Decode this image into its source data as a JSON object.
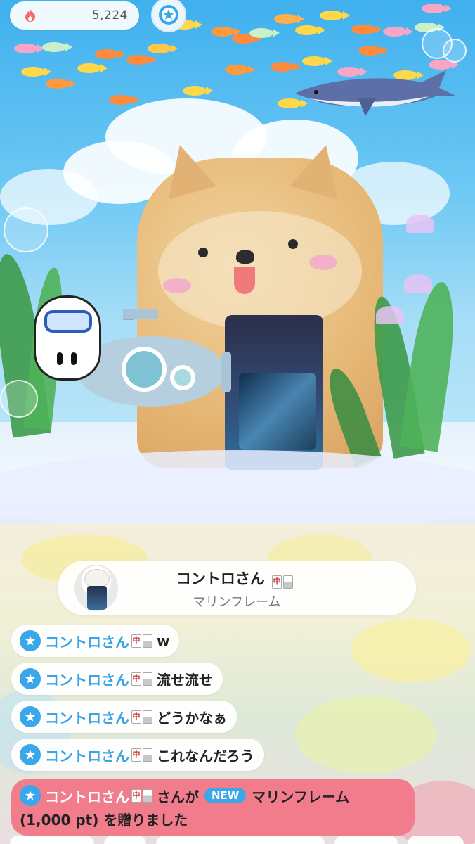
{
  "header": {
    "point_count": "5,224",
    "point_icon": "flame-icon",
    "badge_icon": "star-badge-icon"
  },
  "gift_banner": {
    "user_name": "コントロさん",
    "item_name": "マリンフレーム"
  },
  "chat": {
    "messages": [
      {
        "user": "コントロさん",
        "text": "w"
      },
      {
        "user": "コントロさん",
        "text": "流せ流せ"
      },
      {
        "user": "コントロさん",
        "text": "どうかなぁ"
      },
      {
        "user": "コントロさん",
        "text": "これなんだろう"
      }
    ],
    "gift_message": {
      "user": "コントロさん",
      "suffix": "さんが",
      "badge": "NEW",
      "item": "マリンフレーム",
      "line2": "(1,000 pt) を贈りました"
    }
  },
  "colors": {
    "accent_blue": "#3aa7ea",
    "gift_pink": "#f07c8c"
  }
}
